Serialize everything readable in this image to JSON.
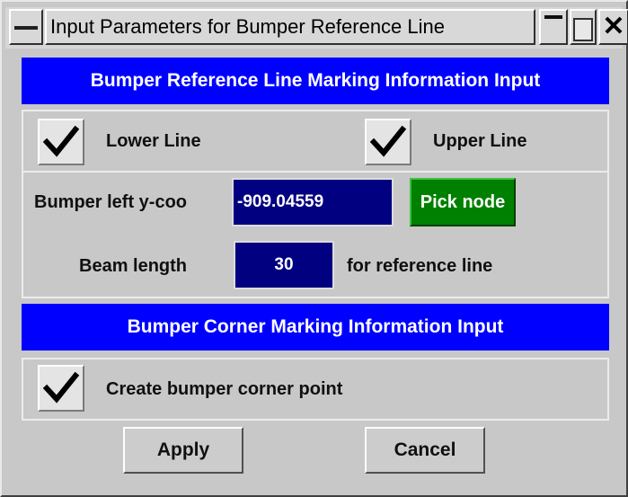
{
  "window": {
    "title": "Input Parameters for Bumper Reference Line"
  },
  "reference_line_section": {
    "header": "Bumper Reference Line Marking Information Input",
    "lower_line": {
      "label": "Lower Line",
      "checked": true
    },
    "upper_line": {
      "label": "Upper Line",
      "checked": true
    },
    "bumper_left": {
      "label": "Bumper left y-coo",
      "value": "-909.04559"
    },
    "pick_node_label": "Pick node",
    "beam_length": {
      "label": "Beam length",
      "value": "30",
      "suffix": "for reference line"
    }
  },
  "corner_section": {
    "header": "Bumper Corner Marking Information Input",
    "create_corner": {
      "label": "Create bumper corner point",
      "checked": true
    }
  },
  "buttons": {
    "apply": "Apply",
    "cancel": "Cancel"
  },
  "colors": {
    "section_header_bg": "#0000ff",
    "field_bg": "#000080",
    "pick_button_bg": "#008000"
  }
}
